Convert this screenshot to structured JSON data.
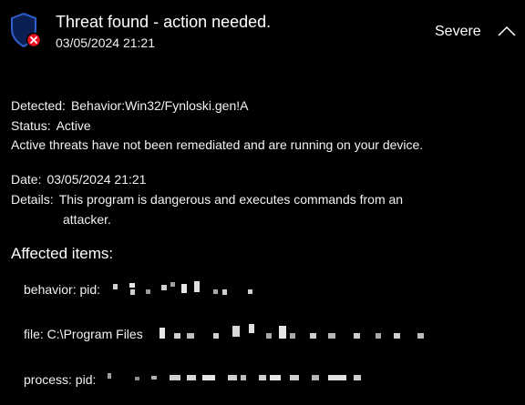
{
  "header": {
    "title": "Threat found - action needed.",
    "date": "03/05/2024 21:21",
    "severity": "Severe",
    "icons": {
      "shield": "shield-error-icon",
      "collapse": "chevron-up-icon"
    },
    "colors": {
      "shield": "#1a3a8f",
      "badge": "#e81123",
      "background": "#000000"
    }
  },
  "detection": {
    "detected_label": "Detected:",
    "detected_value": "Behavior:Win32/Fynloski.gen!A",
    "status_label": "Status:",
    "status_value": "Active",
    "message": "Active threats have not been remediated and are running on your device.",
    "date_label": "Date:",
    "date_value": "03/05/2024 21:21",
    "details_label": "Details:",
    "details_line1": "This program is dangerous and executes commands from an",
    "details_line2": "attacker."
  },
  "affected": {
    "heading": "Affected items:",
    "items": [
      {
        "prefix": "behavior: pid:"
      },
      {
        "prefix": "file: C:\\Program Files"
      },
      {
        "prefix": "process: pid:"
      }
    ]
  }
}
